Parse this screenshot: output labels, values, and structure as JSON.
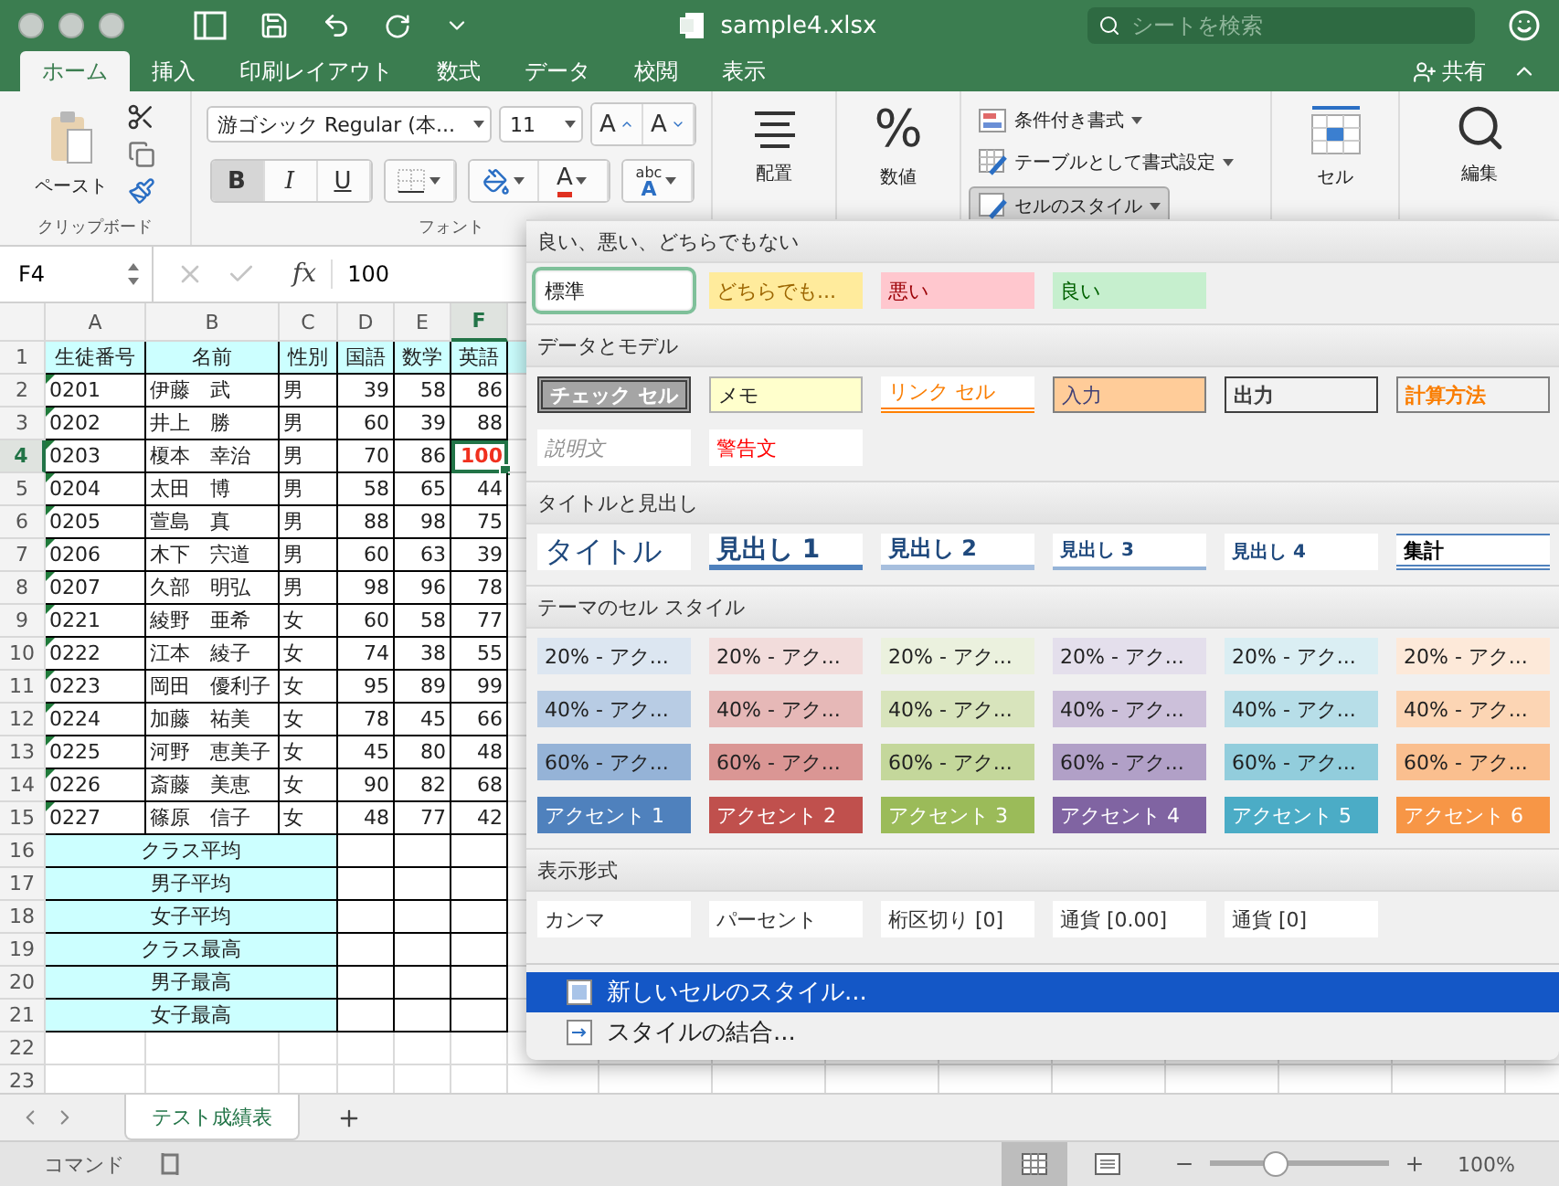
{
  "title_bar": {
    "title": "sample4.xlsx",
    "search": {
      "placeholder": "シートを検索"
    }
  },
  "ribbon_tabs": [
    {
      "label": "ホーム",
      "selected": true
    },
    {
      "label": "挿入",
      "selected": false
    },
    {
      "label": "印刷レイアウト",
      "selected": false
    },
    {
      "label": "数式",
      "selected": false
    },
    {
      "label": "データ",
      "selected": false
    },
    {
      "label": "校閲",
      "selected": false
    },
    {
      "label": "表示",
      "selected": false
    }
  ],
  "share": {
    "label": "共有"
  },
  "ribbon": {
    "clipboard": {
      "paste": "ペースト",
      "group_label": "クリップボード"
    },
    "font": {
      "font_name": "游ゴシック Regular (本...",
      "font_size": "11",
      "grow": "A",
      "shrink": "A",
      "styles": [
        {
          "label": "B",
          "kind": "bold",
          "selected": true
        },
        {
          "label": "I",
          "kind": "italic",
          "selected": false
        },
        {
          "label": "U",
          "kind": "underline",
          "selected": false
        }
      ],
      "font_color": "A",
      "phonetic": {
        "top": "abc",
        "bottom": "A"
      },
      "group_label": "フォント"
    },
    "alignment": {
      "label": "配置"
    },
    "number": {
      "symbol": "%",
      "label": "数値"
    },
    "styles": [
      {
        "label": "条件付き書式",
        "kind": "conditional",
        "selected": false
      },
      {
        "label": "テーブルとして書式設定",
        "kind": "table",
        "selected": false
      },
      {
        "label": "セルのスタイル",
        "kind": "cell",
        "selected": true
      }
    ],
    "cells": {
      "label": "セル"
    },
    "editing": {
      "label": "編集"
    }
  },
  "formula_bar": {
    "name_box": "F4",
    "function_label": "fx",
    "value": "100"
  },
  "sheet": {
    "columns": [
      {
        "label": "A",
        "selected": false
      },
      {
        "label": "B",
        "selected": false
      },
      {
        "label": "C",
        "selected": false
      },
      {
        "label": "D",
        "selected": false
      },
      {
        "label": "E",
        "selected": false
      },
      {
        "label": "F",
        "selected": true
      }
    ],
    "rows": [
      {
        "number": "1",
        "selected": false,
        "kind": "header",
        "cells": [
          "生徒番号",
          "名前",
          "性別",
          "国語",
          "数学",
          "英語"
        ]
      },
      {
        "number": "2",
        "selected": false,
        "kind": "data",
        "marker": true,
        "cells": [
          "0201",
          "伊藤　武",
          "男",
          "39",
          "58",
          "86"
        ]
      },
      {
        "number": "3",
        "selected": false,
        "kind": "data",
        "marker": true,
        "cells": [
          "0202",
          "井上　勝",
          "男",
          "60",
          "39",
          "88"
        ]
      },
      {
        "number": "4",
        "selected": true,
        "kind": "data",
        "marker": true,
        "cells": [
          "0203",
          "榎本　幸治",
          "男",
          "70",
          "86",
          {
            "text": "100",
            "color": "#f0301e"
          }
        ]
      },
      {
        "number": "5",
        "selected": false,
        "kind": "data",
        "marker": true,
        "cells": [
          "0204",
          "太田　博",
          "男",
          "58",
          "65",
          "44"
        ]
      },
      {
        "number": "6",
        "selected": false,
        "kind": "data",
        "marker": true,
        "cells": [
          "0205",
          "萱島　真",
          "男",
          "88",
          "98",
          "75"
        ]
      },
      {
        "number": "7",
        "selected": false,
        "kind": "data",
        "marker": true,
        "cells": [
          "0206",
          "木下　宍道",
          "男",
          "60",
          "63",
          "39"
        ]
      },
      {
        "number": "8",
        "selected": false,
        "kind": "data",
        "marker": true,
        "cells": [
          "0207",
          "久部　明弘",
          "男",
          "98",
          "96",
          "78"
        ]
      },
      {
        "number": "9",
        "selected": false,
        "kind": "data",
        "marker": true,
        "cells": [
          "0221",
          "綾野　亜希",
          "女",
          "60",
          "58",
          "77"
        ]
      },
      {
        "number": "10",
        "selected": false,
        "kind": "data",
        "marker": true,
        "cells": [
          "0222",
          "江本　綾子",
          "女",
          "74",
          "38",
          "55"
        ]
      },
      {
        "number": "11",
        "selected": false,
        "kind": "data",
        "marker": true,
        "cells": [
          "0223",
          "岡田　優利子",
          "女",
          "95",
          "89",
          "99"
        ]
      },
      {
        "number": "12",
        "selected": false,
        "kind": "data",
        "marker": true,
        "cells": [
          "0224",
          "加藤　祐美",
          "女",
          "78",
          "45",
          "66"
        ]
      },
      {
        "number": "13",
        "selected": false,
        "kind": "data",
        "marker": true,
        "cells": [
          "0225",
          "河野　恵美子",
          "女",
          "45",
          "80",
          "48"
        ]
      },
      {
        "number": "14",
        "selected": false,
        "kind": "data",
        "marker": true,
        "cells": [
          "0226",
          "斎藤　美恵",
          "女",
          "90",
          "82",
          "68"
        ]
      },
      {
        "number": "15",
        "selected": false,
        "kind": "data",
        "marker": true,
        "cells": [
          "0227",
          "篠原　信子",
          "女",
          "48",
          "77",
          "42"
        ]
      },
      {
        "number": "16",
        "selected": false,
        "kind": "summary",
        "label": "クラス平均"
      },
      {
        "number": "17",
        "selected": false,
        "kind": "summary",
        "label": "男子平均"
      },
      {
        "number": "18",
        "selected": false,
        "kind": "summary",
        "label": "女子平均"
      },
      {
        "number": "19",
        "selected": false,
        "kind": "summary",
        "label": "クラス最高"
      },
      {
        "number": "20",
        "selected": false,
        "kind": "summary",
        "label": "男子最高"
      },
      {
        "number": "21",
        "selected": false,
        "kind": "summary",
        "label": "女子最高"
      },
      {
        "number": "22",
        "selected": false,
        "kind": "empty"
      },
      {
        "number": "23",
        "selected": false,
        "kind": "empty"
      }
    ]
  },
  "cell_styles_menu": {
    "sections": [
      {
        "title": "良い、悪い、どちらでもない",
        "items": [
          {
            "label": "標準",
            "kind": "normal",
            "selected": true
          },
          {
            "label": "どちらでも...",
            "kind": "neutral",
            "selected": false
          },
          {
            "label": "悪い",
            "kind": "bad",
            "selected": false
          },
          {
            "label": "良い",
            "kind": "good",
            "selected": false
          }
        ]
      },
      {
        "title": "データとモデル",
        "items": [
          {
            "label": "チェック セル",
            "kind": "check",
            "selected": false
          },
          {
            "label": "メモ",
            "kind": "note",
            "selected": false
          },
          {
            "label": "リンク セル",
            "kind": "linked",
            "selected": false
          },
          {
            "label": "入力",
            "kind": "input",
            "selected": false
          },
          {
            "label": "出力",
            "kind": "output",
            "selected": false
          },
          {
            "label": "計算方法",
            "kind": "calc",
            "selected": false
          },
          {
            "label": "説明文",
            "kind": "explanatory",
            "selected": false
          },
          {
            "label": "警告文",
            "kind": "warning",
            "selected": false
          }
        ]
      },
      {
        "title": "タイトルと見出し",
        "items": [
          {
            "label": "タイトル",
            "kind": "title",
            "selected": false
          },
          {
            "label": "見出し 1",
            "kind": "h1",
            "selected": false
          },
          {
            "label": "見出し 2",
            "kind": "h2",
            "selected": false
          },
          {
            "label": "見出し 3",
            "kind": "h3",
            "selected": false
          },
          {
            "label": "見出し 4",
            "kind": "h4",
            "selected": false
          },
          {
            "label": "集計",
            "kind": "total",
            "selected": false
          }
        ]
      },
      {
        "title": "テーマのセル スタイル",
        "items": [
          {
            "label": "20% - アク...",
            "kind": "accent20",
            "color": "#dce6f1",
            "selected": false
          },
          {
            "label": "20% - アク...",
            "kind": "accent20",
            "color": "#f2dcdb",
            "selected": false
          },
          {
            "label": "20% - アク...",
            "kind": "accent20",
            "color": "#ebf1de",
            "selected": false
          },
          {
            "label": "20% - アク...",
            "kind": "accent20",
            "color": "#e4dfec",
            "selected": false
          },
          {
            "label": "20% - アク...",
            "kind": "accent20",
            "color": "#daeef3",
            "selected": false
          },
          {
            "label": "20% - アク...",
            "kind": "accent20",
            "color": "#fde9d9",
            "selected": false
          },
          {
            "label": "40% - アク...",
            "kind": "accent40",
            "color": "#b8cce4",
            "selected": false
          },
          {
            "label": "40% - アク...",
            "kind": "accent40",
            "color": "#e6b8b7",
            "selected": false
          },
          {
            "label": "40% - アク...",
            "kind": "accent40",
            "color": "#d8e4bc",
            "selected": false
          },
          {
            "label": "40% - アク...",
            "kind": "accent40",
            "color": "#ccc0da",
            "selected": false
          },
          {
            "label": "40% - アク...",
            "kind": "accent40",
            "color": "#b7dee8",
            "selected": false
          },
          {
            "label": "40% - アク...",
            "kind": "accent40",
            "color": "#fcd5b4",
            "selected": false
          },
          {
            "label": "60% - アク...",
            "kind": "accent60",
            "color": "#95b3d7",
            "selected": false
          },
          {
            "label": "60% - アク...",
            "kind": "accent60",
            "color": "#da9694",
            "selected": false
          },
          {
            "label": "60% - アク...",
            "kind": "accent60",
            "color": "#c4d79b",
            "selected": false
          },
          {
            "label": "60% - アク...",
            "kind": "accent60",
            "color": "#b1a0c7",
            "selected": false
          },
          {
            "label": "60% - アク...",
            "kind": "accent60",
            "color": "#92cddc",
            "selected": false
          },
          {
            "label": "60% - アク...",
            "kind": "accent60",
            "color": "#fabf8f",
            "selected": false
          },
          {
            "label": "アクセント 1",
            "kind": "accent",
            "color": "#4f81bd",
            "selected": false
          },
          {
            "label": "アクセント 2",
            "kind": "accent",
            "color": "#c0504d",
            "selected": false
          },
          {
            "label": "アクセント 3",
            "kind": "accent",
            "color": "#9bbb59",
            "selected": false
          },
          {
            "label": "アクセント 4",
            "kind": "accent",
            "color": "#8064a2",
            "selected": false
          },
          {
            "label": "アクセント 5",
            "kind": "accent",
            "color": "#4bacc6",
            "selected": false
          },
          {
            "label": "アクセント 6",
            "kind": "accent",
            "color": "#f79646",
            "selected": false
          }
        ]
      },
      {
        "title": "表示形式",
        "items": [
          {
            "label": "カンマ",
            "kind": "plain",
            "selected": false
          },
          {
            "label": "パーセント",
            "kind": "plain",
            "selected": false
          },
          {
            "label": "桁区切り [0]",
            "kind": "plain",
            "selected": false
          },
          {
            "label": "通貨 [0.00]",
            "kind": "plain",
            "selected": false
          },
          {
            "label": "通貨 [0]",
            "kind": "plain",
            "selected": false
          }
        ]
      }
    ],
    "actions": [
      {
        "label": "新しいセルのスタイル...",
        "kind": "new",
        "selected": true
      },
      {
        "label": "スタイルの結合...",
        "kind": "merge",
        "selected": false
      }
    ]
  },
  "sheet_tabs": [
    {
      "label": "テスト成績表",
      "selected": true
    }
  ],
  "status_bar": {
    "mode": "コマンド",
    "views": [
      {
        "kind": "normal",
        "selected": true
      },
      {
        "kind": "page",
        "selected": false
      }
    ],
    "zoom": {
      "level": 0.36,
      "reading": "100%"
    }
  }
}
